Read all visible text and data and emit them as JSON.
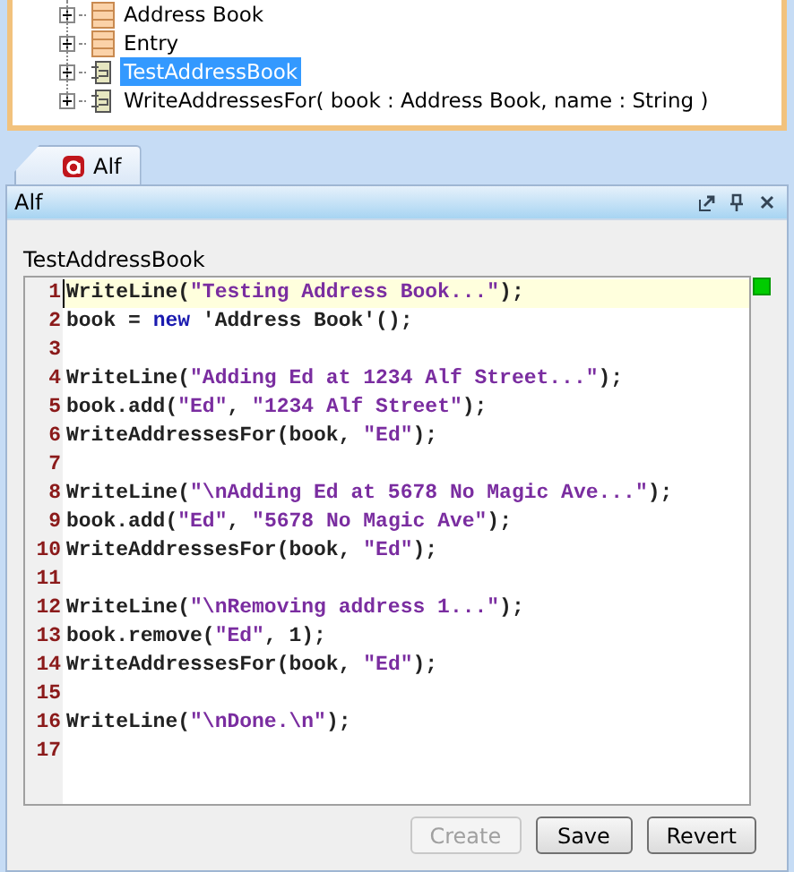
{
  "tree": {
    "items": [
      {
        "label": "Address Book",
        "kind": "class",
        "selected": false,
        "expanded": false
      },
      {
        "label": "Entry",
        "kind": "class",
        "selected": false,
        "expanded": false
      },
      {
        "label": "TestAddressBook",
        "kind": "activity",
        "selected": true,
        "expanded": false
      },
      {
        "label": "WriteAddressesFor( book : Address Book, name : String )",
        "kind": "activity",
        "selected": false,
        "expanded": false
      }
    ]
  },
  "tabs": [
    {
      "label": "Alf",
      "selected": true
    }
  ],
  "panel": {
    "title": "Alf",
    "editor_label": "TestAddressBook",
    "code": [
      {
        "number": "1",
        "current": true,
        "tokens": [
          {
            "kind": "plain",
            "text": "WriteLine("
          },
          {
            "kind": "string",
            "text": "\"Testing Address Book...\""
          },
          {
            "kind": "plain",
            "text": ");"
          }
        ]
      },
      {
        "number": "2",
        "current": false,
        "tokens": [
          {
            "kind": "plain",
            "text": "book = "
          },
          {
            "kind": "keyword",
            "text": "new"
          },
          {
            "kind": "plain",
            "text": " 'Address Book'();"
          }
        ]
      },
      {
        "number": "3",
        "current": false
      },
      {
        "number": "4",
        "current": false,
        "tokens": [
          {
            "kind": "plain",
            "text": "WriteLine("
          },
          {
            "kind": "string",
            "text": "\"Adding Ed at 1234 Alf Street...\""
          },
          {
            "kind": "plain",
            "text": ");"
          }
        ]
      },
      {
        "number": "5",
        "current": false,
        "tokens": [
          {
            "kind": "plain",
            "text": "book.add("
          },
          {
            "kind": "string",
            "text": "\"Ed\""
          },
          {
            "kind": "plain",
            "text": ", "
          },
          {
            "kind": "string",
            "text": "\"1234 Alf Street\""
          },
          {
            "kind": "plain",
            "text": ");"
          }
        ]
      },
      {
        "number": "6",
        "current": false,
        "tokens": [
          {
            "kind": "plain",
            "text": "WriteAddressesFor(book, "
          },
          {
            "kind": "string",
            "text": "\"Ed\""
          },
          {
            "kind": "plain",
            "text": ");"
          }
        ]
      },
      {
        "number": "7",
        "current": false
      },
      {
        "number": "8",
        "current": false,
        "tokens": [
          {
            "kind": "plain",
            "text": "WriteLine("
          },
          {
            "kind": "string",
            "text": "\"\\nAdding Ed at 5678 No Magic Ave...\""
          },
          {
            "kind": "plain",
            "text": ");"
          }
        ]
      },
      {
        "number": "9",
        "current": false,
        "tokens": [
          {
            "kind": "plain",
            "text": "book.add("
          },
          {
            "kind": "string",
            "text": "\"Ed\""
          },
          {
            "kind": "plain",
            "text": ", "
          },
          {
            "kind": "string",
            "text": "\"5678 No Magic Ave\""
          },
          {
            "kind": "plain",
            "text": ");"
          }
        ]
      },
      {
        "number": "10",
        "current": false,
        "tokens": [
          {
            "kind": "plain",
            "text": "WriteAddressesFor(book, "
          },
          {
            "kind": "string",
            "text": "\"Ed\""
          },
          {
            "kind": "plain",
            "text": ");"
          }
        ]
      },
      {
        "number": "11",
        "current": false
      },
      {
        "number": "12",
        "current": false,
        "tokens": [
          {
            "kind": "plain",
            "text": "WriteLine("
          },
          {
            "kind": "string",
            "text": "\"\\nRemoving address 1...\""
          },
          {
            "kind": "plain",
            "text": ");"
          }
        ]
      },
      {
        "number": "13",
        "current": false,
        "tokens": [
          {
            "kind": "plain",
            "text": "book.remove("
          },
          {
            "kind": "string",
            "text": "\"Ed\""
          },
          {
            "kind": "plain",
            "text": ", 1);"
          }
        ]
      },
      {
        "number": "14",
        "current": false,
        "tokens": [
          {
            "kind": "plain",
            "text": "WriteAddressesFor(book, "
          },
          {
            "kind": "string",
            "text": "\"Ed\""
          },
          {
            "kind": "plain",
            "text": ");"
          }
        ]
      },
      {
        "number": "15",
        "current": false
      },
      {
        "number": "16",
        "current": false,
        "tokens": [
          {
            "kind": "plain",
            "text": "WriteLine("
          },
          {
            "kind": "string",
            "text": "\"\\nDone.\\n\""
          },
          {
            "kind": "plain",
            "text": ");"
          }
        ]
      },
      {
        "number": "17",
        "current": false
      }
    ],
    "buttons": [
      {
        "label": "Create",
        "disabled": true
      },
      {
        "label": "Save",
        "disabled": false
      },
      {
        "label": "Revert",
        "disabled": false
      }
    ]
  }
}
